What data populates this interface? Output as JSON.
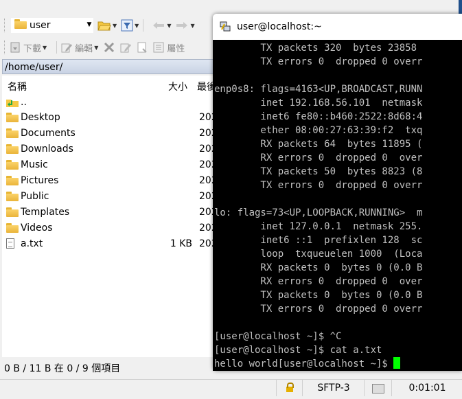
{
  "file_manager": {
    "location_combo": "user",
    "toolbar2": {
      "download": "下載",
      "edit": "編輯",
      "properties": "屬性"
    },
    "path": "/home/user/",
    "columns": {
      "name": "名稱",
      "size": "大小",
      "modified": "最後"
    },
    "rows": [
      {
        "name": "..",
        "size": "",
        "date": "",
        "type": "parent"
      },
      {
        "name": "Desktop",
        "size": "",
        "date": "202",
        "type": "folder"
      },
      {
        "name": "Documents",
        "size": "",
        "date": "202",
        "type": "folder"
      },
      {
        "name": "Downloads",
        "size": "",
        "date": "202",
        "type": "folder"
      },
      {
        "name": "Music",
        "size": "",
        "date": "202",
        "type": "folder"
      },
      {
        "name": "Pictures",
        "size": "",
        "date": "202",
        "type": "folder"
      },
      {
        "name": "Public",
        "size": "",
        "date": "202",
        "type": "folder"
      },
      {
        "name": "Templates",
        "size": "",
        "date": "202",
        "type": "folder"
      },
      {
        "name": "Videos",
        "size": "",
        "date": "202",
        "type": "folder"
      },
      {
        "name": "a.txt",
        "size": "1 KB",
        "date": "202",
        "type": "file"
      }
    ],
    "first_row_date": "202",
    "status": "0 B / 11 B 在 0 / 9 個項目",
    "bottom_status": {
      "protocol": "SFTP-3",
      "time": "0:01:01"
    }
  },
  "terminal": {
    "title": "user@localhost:~",
    "lines": [
      "        TX packets 320  bytes 23858",
      "        TX errors 0  dropped 0 overr",
      "",
      "enp0s8: flags=4163<UP,BROADCAST,RUNN",
      "        inet 192.168.56.101  netmask",
      "        inet6 fe80::b460:2522:8d68:4",
      "        ether 08:00:27:63:39:f2  txq",
      "        RX packets 64  bytes 11895 (",
      "        RX errors 0  dropped 0  over",
      "        TX packets 50  bytes 8823 (8",
      "        TX errors 0  dropped 0 overr",
      "",
      "lo: flags=73<UP,LOOPBACK,RUNNING>  m",
      "        inet 127.0.0.1  netmask 255.",
      "        inet6 ::1  prefixlen 128  sc",
      "        loop  txqueuelen 1000  (Loca",
      "        RX packets 0  bytes 0 (0.0 B",
      "        RX errors 0  dropped 0  over",
      "        TX packets 0  bytes 0 (0.0 B",
      "        TX errors 0  dropped 0 overr",
      "",
      "[user@localhost ~]$ ^C",
      "[user@localhost ~]$ cat a.txt",
      "hello world[user@localhost ~]$ "
    ]
  }
}
